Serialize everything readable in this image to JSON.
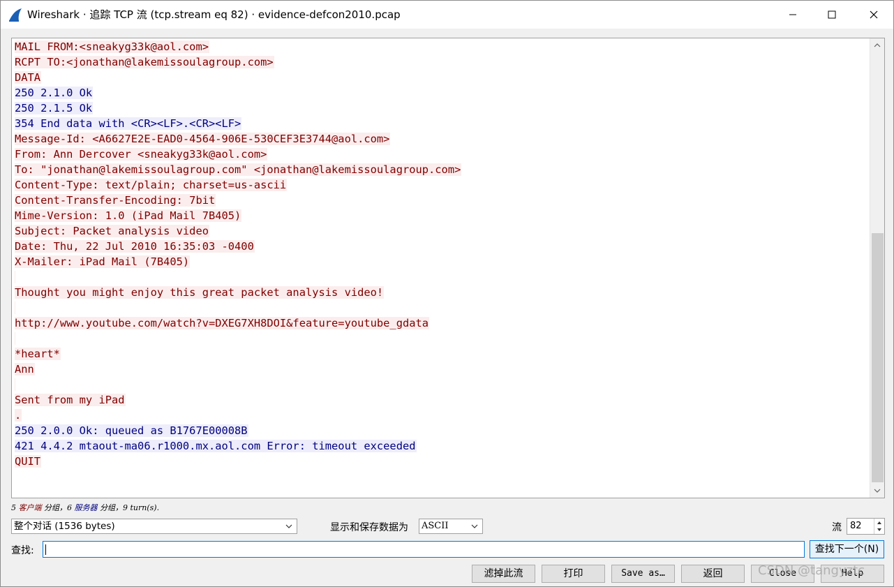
{
  "window": {
    "title": "Wireshark · 追踪 TCP 流 (tcp.stream eq 82) · evidence-defcon2010.pcap"
  },
  "stream_lines": [
    {
      "dir": "client",
      "text": "MAIL FROM:<sneakyg33k@aol.com>"
    },
    {
      "dir": "client",
      "text": "RCPT TO:<jonathan@lakemissoulagroup.com>"
    },
    {
      "dir": "client",
      "text": "DATA"
    },
    {
      "dir": "server",
      "text": "250 2.1.0 Ok"
    },
    {
      "dir": "server",
      "text": "250 2.1.5 Ok"
    },
    {
      "dir": "server",
      "text": "354 End data with <CR><LF>.<CR><LF>"
    },
    {
      "dir": "client",
      "text": "Message-Id: <A6627E2E-EAD0-4564-906E-530CEF3E3744@aol.com>"
    },
    {
      "dir": "client",
      "text": "From: Ann Dercover <sneakyg33k@aol.com>"
    },
    {
      "dir": "client",
      "text": "To: \"jonathan@lakemissoulagroup.com\" <jonathan@lakemissoulagroup.com>"
    },
    {
      "dir": "client",
      "text": "Content-Type: text/plain; charset=us-ascii"
    },
    {
      "dir": "client",
      "text": "Content-Transfer-Encoding: 7bit"
    },
    {
      "dir": "client",
      "text": "Mime-Version: 1.0 (iPad Mail 7B405)"
    },
    {
      "dir": "client",
      "text": "Subject: Packet analysis video"
    },
    {
      "dir": "client",
      "text": "Date: Thu, 22 Jul 2010 16:35:03 -0400"
    },
    {
      "dir": "client",
      "text": "X-Mailer: iPad Mail (7B405)"
    },
    {
      "dir": "client",
      "text": ""
    },
    {
      "dir": "client",
      "text": "Thought you might enjoy this great packet analysis video!"
    },
    {
      "dir": "client",
      "text": ""
    },
    {
      "dir": "client",
      "text": "http://www.youtube.com/watch?v=DXEG7XH8DOI&feature=youtube_gdata"
    },
    {
      "dir": "client",
      "text": ""
    },
    {
      "dir": "client",
      "text": "*heart*"
    },
    {
      "dir": "client",
      "text": "Ann"
    },
    {
      "dir": "client",
      "text": ""
    },
    {
      "dir": "client",
      "text": "Sent from my iPad"
    },
    {
      "dir": "client",
      "text": "."
    },
    {
      "dir": "server",
      "text": "250 2.0.0 Ok: queued as B1767E00008B"
    },
    {
      "dir": "server",
      "text": "421 4.4.2 mtaout-ma06.r1000.mx.aol.com Error: timeout exceeded"
    },
    {
      "dir": "client",
      "text": "QUIT"
    }
  ],
  "status": {
    "part1": "5 ",
    "client_word": "客户端",
    "part2": " 分组，6 ",
    "server_word": "服务器",
    "part3": " 分组，9 turn(s)."
  },
  "controls": {
    "conversation_value": "整个对话 (1536 bytes)",
    "show_save_label": "显示和保存数据为",
    "format_value": "ASCII",
    "stream_label": "流",
    "stream_value": "82",
    "find_label": "查找:",
    "find_value": "",
    "find_next_label": "查找下一个(N)"
  },
  "buttons": {
    "filter_out": "滤掉此流",
    "print": "打印",
    "save_as": "Save as…",
    "back": "返回",
    "close": "Close",
    "help": "Help"
  },
  "watermark": "CSDN @tangyztc",
  "colors": {
    "client_text": "#7f0000",
    "client_bg": "#fbeded",
    "server_text": "#00007f",
    "server_bg": "#ededfb",
    "focus_border": "#0078d7"
  }
}
